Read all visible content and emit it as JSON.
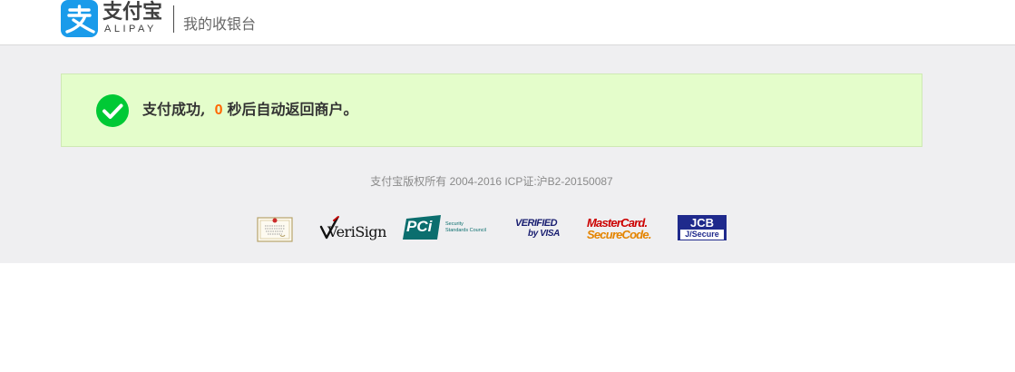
{
  "header": {
    "brand_cn": "支付宝",
    "brand_en": "ALIPAY",
    "subtitle": "我的收银台"
  },
  "status": {
    "prefix": "支付成功,",
    "countdown": "0",
    "suffix": "秒后自动返回商户。"
  },
  "footer": {
    "copyright": "支付宝版权所有 2004-2016 ICP证:沪B2-20150087"
  },
  "badges": {
    "verisign": "VeriSign",
    "pci_short": "PCi",
    "pci_line1": "Security",
    "pci_line2": "Standards Council",
    "visa_line1": "VERIFIED",
    "visa_line2": "by VISA",
    "mc_line1": "MasterCard.",
    "mc_line2": "SecureCode.",
    "jcb_line1": "JCB",
    "jcb_line2": "J/Secure"
  },
  "colors": {
    "brand_blue": "#1a9bea",
    "success_bg": "#e4fdcb",
    "success_icon": "#00c935",
    "countdown": "#ff6600"
  }
}
